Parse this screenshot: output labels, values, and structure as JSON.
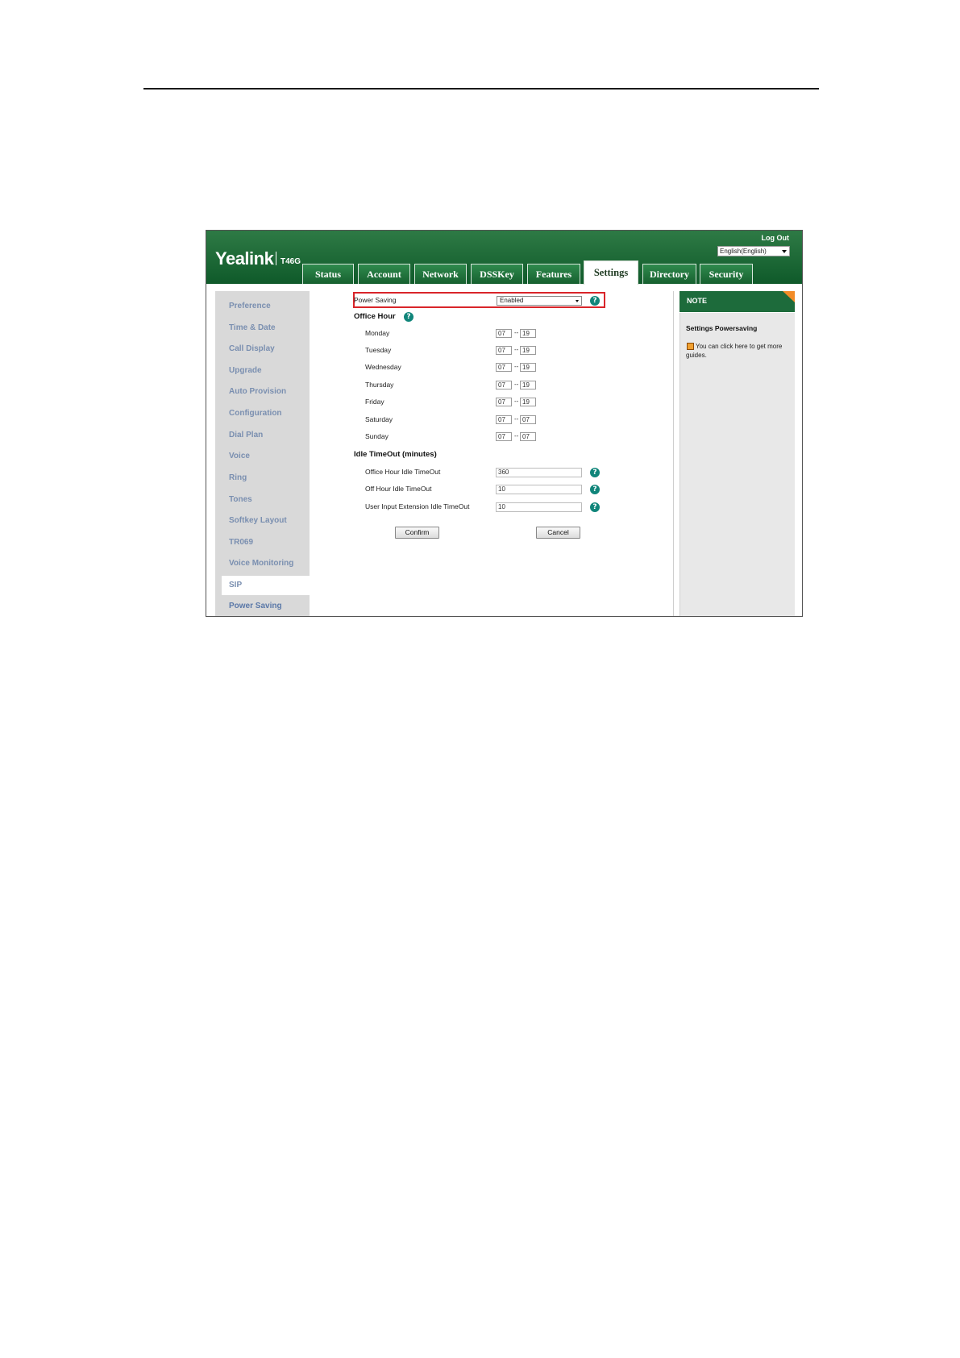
{
  "header": {
    "logo": "Yealink",
    "model": "T46G",
    "logout": "Log Out",
    "language": "English(English)"
  },
  "tabs": [
    {
      "label": "Status"
    },
    {
      "label": "Account"
    },
    {
      "label": "Network"
    },
    {
      "label": "DSSKey"
    },
    {
      "label": "Features"
    },
    {
      "label": "Settings",
      "active": true
    },
    {
      "label": "Directory"
    },
    {
      "label": "Security"
    }
  ],
  "sidebar": {
    "items": [
      {
        "label": "Preference"
      },
      {
        "label": "Time & Date"
      },
      {
        "label": "Call Display"
      },
      {
        "label": "Upgrade"
      },
      {
        "label": "Auto Provision"
      },
      {
        "label": "Configuration"
      },
      {
        "label": "Dial Plan"
      },
      {
        "label": "Voice"
      },
      {
        "label": "Ring"
      },
      {
        "label": "Tones"
      },
      {
        "label": "Softkey Layout"
      },
      {
        "label": "TR069"
      },
      {
        "label": "Voice Monitoring"
      },
      {
        "label": "SIP"
      },
      {
        "label": "Power Saving",
        "active": true
      }
    ]
  },
  "form": {
    "power_saving_label": "Power Saving",
    "power_saving_value": "Enabled",
    "office_hour_title": "Office Hour",
    "days": [
      {
        "label": "Monday",
        "start": "07",
        "end": "19"
      },
      {
        "label": "Tuesday",
        "start": "07",
        "end": "19"
      },
      {
        "label": "Wednesday",
        "start": "07",
        "end": "19"
      },
      {
        "label": "Thursday",
        "start": "07",
        "end": "19"
      },
      {
        "label": "Friday",
        "start": "07",
        "end": "19"
      },
      {
        "label": "Saturday",
        "start": "07",
        "end": "07"
      },
      {
        "label": "Sunday",
        "start": "07",
        "end": "07"
      }
    ],
    "range_separator": "--",
    "idle_title": "Idle TimeOut (minutes)",
    "idle": [
      {
        "label": "Office Hour Idle TimeOut",
        "value": "360"
      },
      {
        "label": "Off Hour Idle TimeOut",
        "value": "10"
      },
      {
        "label": "User Input Extension Idle TimeOut",
        "value": "10"
      }
    ],
    "confirm_label": "Confirm",
    "cancel_label": "Cancel",
    "help_glyph": "?"
  },
  "note": {
    "title": "NOTE",
    "subtitle": "Settings Powersaving",
    "text": "You can click here to get more guides."
  },
  "colors": {
    "header_green": "#1d6b3b",
    "highlight_red": "#d9252a",
    "help_teal": "#10857a",
    "note_orange": "#f28c28"
  }
}
